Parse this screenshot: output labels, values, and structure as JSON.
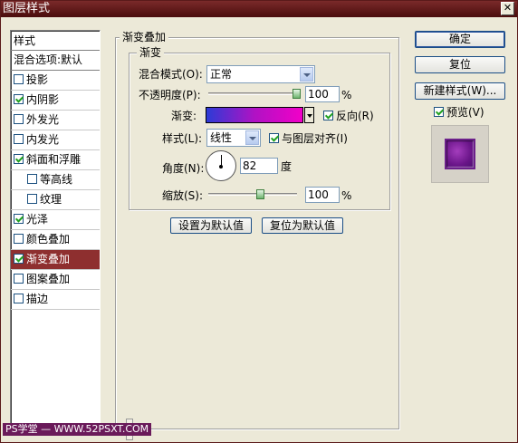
{
  "window": {
    "title": "图层样式",
    "close_symbol": "✕"
  },
  "left_list": {
    "header": "样式",
    "blend_options": "混合选项:默认",
    "items": [
      {
        "label": "投影",
        "checked": false,
        "sub": false,
        "selected": false
      },
      {
        "label": "内阴影",
        "checked": true,
        "sub": false,
        "selected": false
      },
      {
        "label": "外发光",
        "checked": false,
        "sub": false,
        "selected": false
      },
      {
        "label": "内发光",
        "checked": false,
        "sub": false,
        "selected": false
      },
      {
        "label": "斜面和浮雕",
        "checked": true,
        "sub": false,
        "selected": false
      },
      {
        "label": "等高线",
        "checked": false,
        "sub": true,
        "selected": false
      },
      {
        "label": "纹理",
        "checked": false,
        "sub": true,
        "selected": false
      },
      {
        "label": "光泽",
        "checked": true,
        "sub": false,
        "selected": false
      },
      {
        "label": "颜色叠加",
        "checked": false,
        "sub": false,
        "selected": false
      },
      {
        "label": "渐变叠加",
        "checked": true,
        "sub": false,
        "selected": true
      },
      {
        "label": "图案叠加",
        "checked": false,
        "sub": false,
        "selected": false
      },
      {
        "label": "描边",
        "checked": false,
        "sub": false,
        "selected": false
      }
    ]
  },
  "panel": {
    "title": "渐变叠加",
    "subgroup_title": "渐变",
    "blend_mode_label": "混合模式(O):",
    "blend_mode_value": "正常",
    "opacity_label": "不透明度(P):",
    "opacity_value": "100",
    "opacity_unit": "%",
    "opacity_fraction": 1.0,
    "gradient_label": "渐变:",
    "reverse_label": "反向(R)",
    "reverse_checked": true,
    "style_label": "样式(L):",
    "style_value": "线性",
    "align_label": "与图层对齐(I)",
    "align_checked": true,
    "angle_label": "角度(N):",
    "angle_value": "82",
    "angle_unit": "度",
    "scale_label": "缩放(S):",
    "scale_value": "100",
    "scale_unit": "%",
    "scale_fraction": 0.6,
    "set_default_button": "设置为默认值",
    "reset_default_button": "复位为默认值",
    "gradient_colors": [
      "#2c3bd6",
      "#b012c4",
      "#f200c8"
    ]
  },
  "right_buttons": {
    "ok": "确定",
    "reset": "复位",
    "new_style": "新建样式(W)...",
    "preview_label": "预览(V)",
    "preview_checked": true
  },
  "watermark": "PS学堂 — WWW.52PSXT.COM"
}
